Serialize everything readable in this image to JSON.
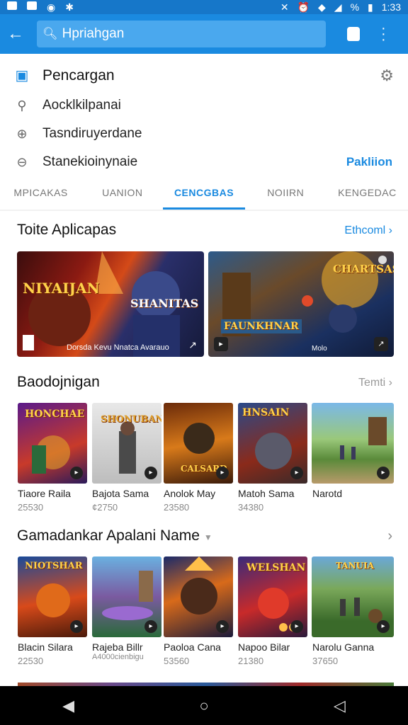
{
  "status": {
    "time": "1:33"
  },
  "search": {
    "query": "Hpriahgan"
  },
  "suggestions": {
    "header": "Pencargan",
    "items": [
      "Aocklkilpanai",
      "Tasndiruyerdane",
      "Stanekioinynaie"
    ],
    "action": "Pakliion"
  },
  "tabs": [
    "MPICAKAS",
    "UANION",
    "CENCGBAS",
    "NOIIRN",
    "KENGEDAC"
  ],
  "section1": {
    "title": "Toite Aplicapas",
    "link": "Ethcoml",
    "cards": [
      {
        "art": "NIYAIJAN",
        "art2": "SHANITAS",
        "caption": "Dorsda Kevu Nnatca Avarauo"
      },
      {
        "art": "CHARTSAS",
        "art2": "FAUNKHNAR",
        "caption": "Molo"
      }
    ]
  },
  "section2": {
    "title": "Baodojnigan",
    "link": "Temti",
    "tiles": [
      {
        "name": "Tiaore Raila",
        "sub": "25530",
        "art": "HONCHAE"
      },
      {
        "name": "Bajota Sama",
        "sub": "¢2750",
        "art": "SHONUBAN"
      },
      {
        "name": "Anolok May",
        "sub": "23580",
        "art": "CALSARD"
      },
      {
        "name": "Matoh Sama",
        "sub": "34380",
        "art": "HNSAIN"
      },
      {
        "name": "Narotd",
        "sub": "",
        "art": ""
      }
    ]
  },
  "section3": {
    "title": "Gamadankar Apalani Name",
    "tiles": [
      {
        "name": "Blacin Silara",
        "sub": "22530",
        "art": "NIOTSHAR"
      },
      {
        "name": "Rajeba Billr",
        "sub": "A4000cienbigu",
        "art": ""
      },
      {
        "name": "Paoloa Cana",
        "sub": "53560",
        "art": ""
      },
      {
        "name": "Napoo Bilar",
        "sub": "21380",
        "art": "WELSHAN"
      },
      {
        "name": "Narolu Ganna",
        "sub": "37650",
        "art": "TANUIA"
      }
    ]
  },
  "colors": {
    "accent": "#1a8ae0",
    "appbar": "#1a8ae0",
    "statusbar": "#1677c9"
  }
}
